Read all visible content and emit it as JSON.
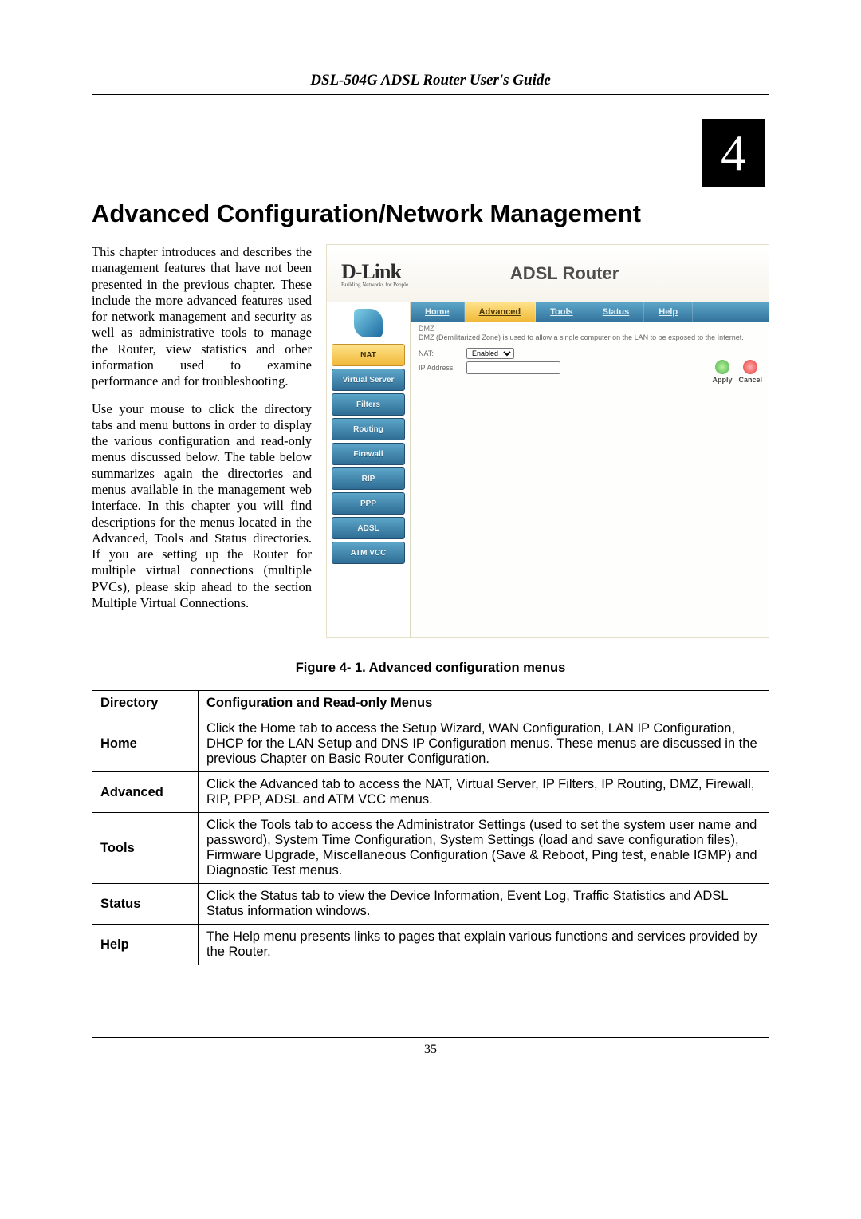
{
  "header": {
    "title": "DSL-504G ADSL Router User's Guide"
  },
  "chapter": {
    "number": "4",
    "title": "Advanced Configuration/Network Management"
  },
  "intro": {
    "p1": "This chapter introduces and describes the management features that have not been presented in the previous chapter. These include the more advanced features used for network management and security as well as administrative tools to manage the Router, view statistics and other information used to examine performance and for troubleshooting.",
    "p2": "Use your mouse to click the directory tabs and menu buttons in order to display the various configuration and read-only menus discussed below.  The table below summarizes again the directories and menus available in the management web interface. In this chapter you will find descriptions for the menus located in the Advanced, Tools and Status directories. If you are setting up the Router for multiple virtual connections (multiple PVCs), please skip ahead to the section Multiple Virtual Connections."
  },
  "screenshot": {
    "brand": "D-Link",
    "brand_tag": "Building Networks for People",
    "product": "ADSL Router",
    "tabs": [
      "Home",
      "Advanced",
      "Tools",
      "Status",
      "Help"
    ],
    "active_tab": "Advanced",
    "sidebar": [
      "NAT",
      "Virtual Server",
      "Filters",
      "Routing",
      "Firewall",
      "RIP",
      "PPP",
      "ADSL",
      "ATM VCC"
    ],
    "active_side": "NAT",
    "section_label": "DMZ",
    "desc": "DMZ (Demilitarized Zone) is used to allow a single computer on the LAN to be exposed to the Internet.",
    "nat_label": "NAT:",
    "nat_value": "Enabled",
    "ip_label": "IP Address:",
    "apply_label": "Apply",
    "cancel_label": "Cancel"
  },
  "figure_caption": "Figure 4- 1. Advanced configuration menus",
  "table": {
    "headers": [
      "Directory",
      "Configuration and Read-only Menus"
    ],
    "rows": [
      {
        "dir": "Home",
        "desc": "Click the Home tab to access the Setup Wizard, WAN Configuration, LAN IP Configuration, DHCP for the LAN Setup and DNS IP Configuration menus. These menus are discussed in the previous Chapter on Basic Router Configuration."
      },
      {
        "dir": "Advanced",
        "desc": "Click the Advanced tab to access the NAT, Virtual Server, IP Filters, IP Routing, DMZ, Firewall, RIP, PPP, ADSL and ATM VCC menus."
      },
      {
        "dir": "Tools",
        "desc": "Click the Tools tab to access the Administrator Settings (used to set the system user name and password), System Time Configuration, System Settings (load and save configuration files), Firmware Upgrade, Miscellaneous Configuration (Save & Reboot, Ping test, enable IGMP) and Diagnostic Test menus."
      },
      {
        "dir": "Status",
        "desc": "Click the Status tab to view the Device Information, Event Log, Traffic Statistics and ADSL Status information windows."
      },
      {
        "dir": "Help",
        "desc": "The Help menu presents links to pages that explain various functions and services provided by the Router."
      }
    ]
  },
  "page_number": "35"
}
